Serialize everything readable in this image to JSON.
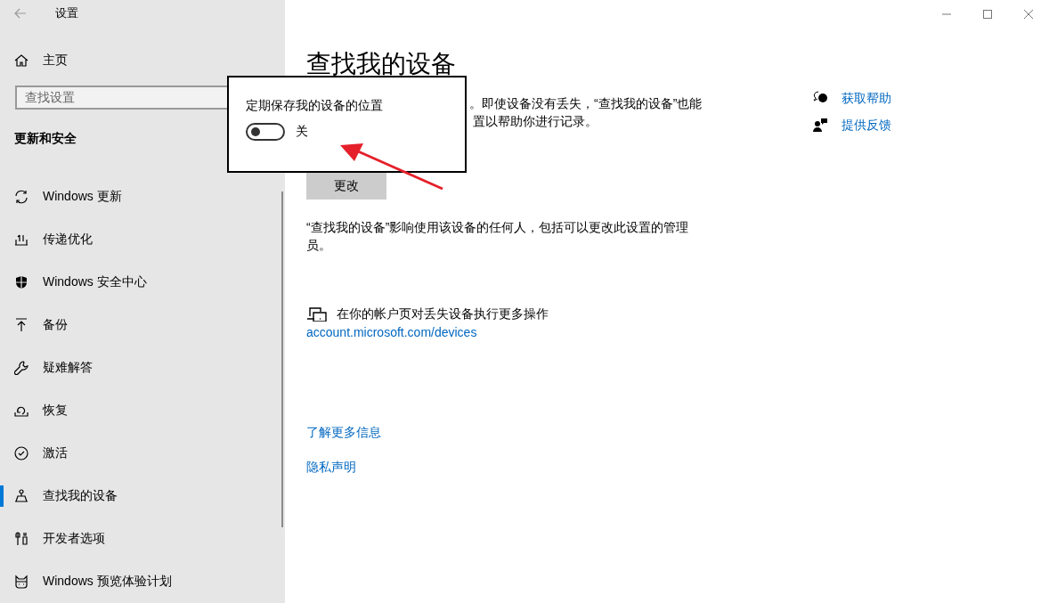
{
  "window": {
    "title": "设置"
  },
  "sidebar": {
    "home": "主页",
    "search": {
      "placeholder": "查找设置"
    },
    "section": "更新和安全",
    "items": [
      {
        "kind": "update",
        "label": "Windows 更新",
        "selected": false
      },
      {
        "kind": "delivery",
        "label": "传递优化",
        "selected": false
      },
      {
        "kind": "shield",
        "label": "Windows 安全中心",
        "selected": false
      },
      {
        "kind": "backup",
        "label": "备份",
        "selected": false
      },
      {
        "kind": "wrench",
        "label": "疑难解答",
        "selected": false
      },
      {
        "kind": "recovery",
        "label": "恢复",
        "selected": false
      },
      {
        "kind": "activation",
        "label": "激活",
        "selected": false
      },
      {
        "kind": "find",
        "label": "查找我的设备",
        "selected": true
      },
      {
        "kind": "developer",
        "label": "开发者选项",
        "selected": false
      },
      {
        "kind": "insider",
        "label": "Windows 预览体验计划",
        "selected": false
      }
    ]
  },
  "main": {
    "title": "查找我的设备",
    "description_lines": [
      "。即使设备没有丢失，“查找我的设备”也能",
      "置以帮助你进行记录。"
    ],
    "change_button": "更改",
    "note": "“查找我的设备”影响使用该设备的任何人，包括可以更改此设置的管理员。",
    "account_text": "在你的帐户页对丢失设备执行更多操作",
    "account_link": "account.microsoft.com/devices",
    "links": [
      "了解更多信息",
      "隐私声明"
    ]
  },
  "help": [
    {
      "kind": "help",
      "label": "获取帮助"
    },
    {
      "kind": "feedback",
      "label": "提供反馈"
    }
  ],
  "popup": {
    "title": "定期保存我的设备的位置",
    "toggle": {
      "on": false,
      "label": "关"
    }
  }
}
